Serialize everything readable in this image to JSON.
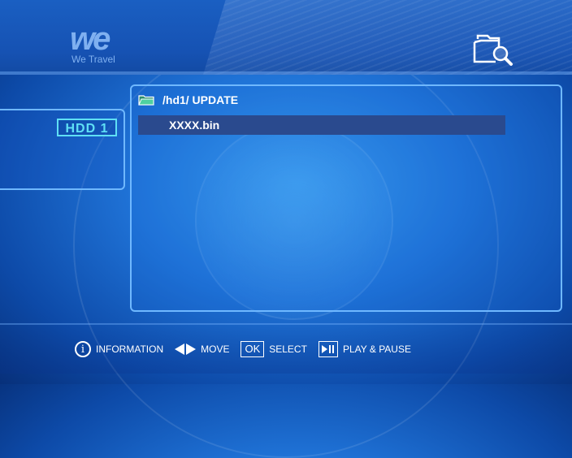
{
  "logo": {
    "big": "we",
    "small": "We Travel"
  },
  "header": {
    "search_icon": "folder-search-icon"
  },
  "sidebar": {
    "device_label": "HDD 1"
  },
  "browser": {
    "path_icon": "folder-icon",
    "path": "/hd1/ UPDATE",
    "files": [
      {
        "name": "XXXX.bin",
        "selected": true
      }
    ]
  },
  "help_bar": {
    "information": "INFORMATION",
    "move": "MOVE",
    "ok_key": "OK",
    "select": "SELECT",
    "play_pause": "PLAY & PAUSE"
  },
  "colors": {
    "accent_cyan": "#5fe0f5",
    "panel_border": "#6fb8ff",
    "selection": "#2a4a8e",
    "folder_green": "#4fd0a0"
  }
}
